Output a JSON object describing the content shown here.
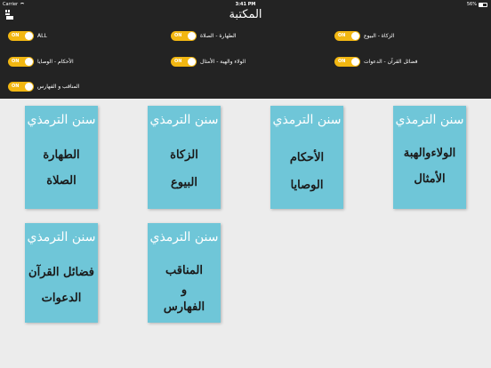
{
  "status_bar": {
    "carrier": "Carrier",
    "time": "3:41 PM",
    "battery": "56%",
    "battery_level": 0.56
  },
  "nav": {
    "title": "المكتبة",
    "menu_icon": "hamburger-icon"
  },
  "colors": {
    "header_bg": "#232323",
    "toggle_on": "#f2b712",
    "book_cover": "#6fc6d8",
    "page_bg": "#ececec"
  },
  "filters": [
    {
      "label": "ALL",
      "state": "ON"
    },
    {
      "label": "الطهارة - الصلاة",
      "state": "ON"
    },
    {
      "label": "الزكاة - البيوع",
      "state": "ON"
    },
    {
      "label": "الأحكام - الوصايا",
      "state": "ON"
    },
    {
      "label": "الولاء والهبة - الأمثال",
      "state": "ON"
    },
    {
      "label": "فضائل القرآن - الدعوات",
      "state": "ON"
    },
    {
      "label": "المناقب و الفهارس",
      "state": "ON"
    }
  ],
  "books": [
    {
      "series": "سنن الترمذي",
      "lines": [
        "الطهارة",
        "الصلاة"
      ]
    },
    {
      "series": "سنن الترمذي",
      "lines": [
        "الزكاة",
        "البيوع"
      ]
    },
    {
      "series": "سنن الترمذي",
      "lines": [
        "الأحكام",
        "الوصايا"
      ]
    },
    {
      "series": "سنن الترمذي",
      "lines": [
        "الولاءوالهبة",
        "الأمثال"
      ]
    },
    {
      "series": "سنن الترمذي",
      "lines": [
        "فضائل القرآن",
        "الدعوات"
      ]
    },
    {
      "series": "سنن الترمذي",
      "lines": [
        "المناقب",
        "و",
        "الفهارس"
      ]
    }
  ]
}
